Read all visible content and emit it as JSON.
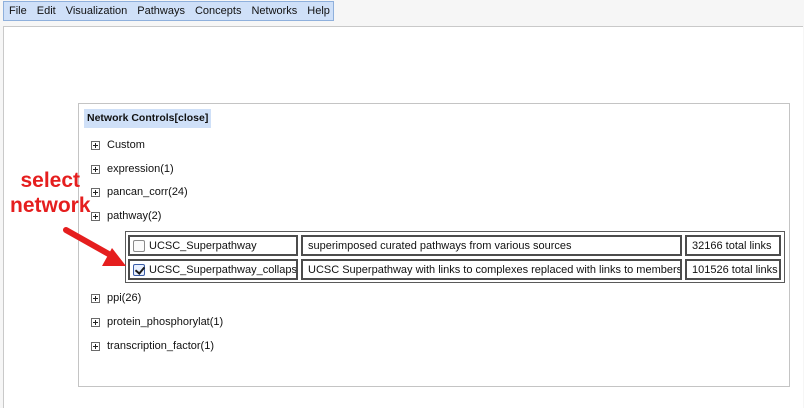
{
  "menu": {
    "items": [
      "File",
      "Edit",
      "Visualization",
      "Pathways",
      "Concepts",
      "Networks",
      "Help"
    ]
  },
  "panel": {
    "title": "Network Controls",
    "close_label": "[close]",
    "groups": [
      {
        "label": "Custom"
      },
      {
        "label": "expression(1)"
      },
      {
        "label": "pancan_corr(24)"
      },
      {
        "label": "pathway(2)"
      },
      {
        "label": "ppi(26)"
      },
      {
        "label": "protein_phosphorylat(1)"
      },
      {
        "label": "transcription_factor(1)"
      }
    ],
    "networks": [
      {
        "name": "UCSC_Superpathway",
        "description": "superimposed curated pathways from various sources",
        "links": "32166 total links",
        "checked": false
      },
      {
        "name": "UCSC_Superpathway_collapsed",
        "description": "UCSC Superpathway with links to complexes replaced with links to members",
        "links": "101526 total links",
        "checked": true
      }
    ]
  },
  "annotation": {
    "line1": "select",
    "line2": "network",
    "color": "#e51e1e"
  }
}
